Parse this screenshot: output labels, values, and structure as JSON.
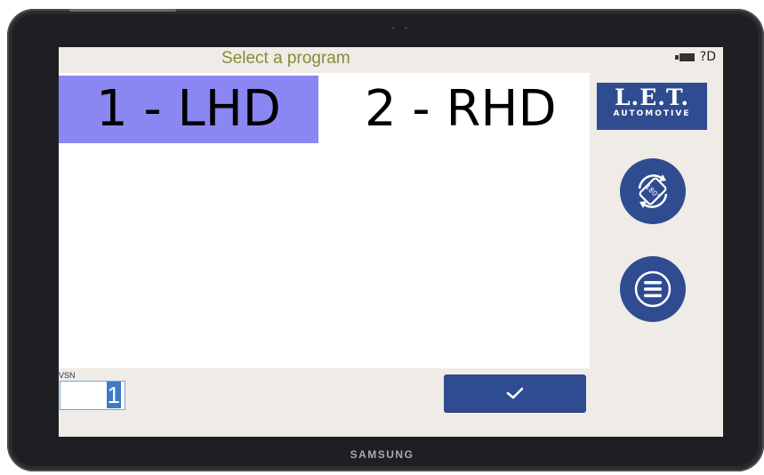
{
  "header": {
    "title": "Select a program",
    "status_text": "?D"
  },
  "programs": [
    {
      "label": "1 - LHD",
      "selected": true
    },
    {
      "label": "2 - RHD",
      "selected": false
    }
  ],
  "logo": {
    "main": "L.E.T.",
    "sub": "AUTOMOTIVE"
  },
  "rotate_button": {
    "icon": "rotate-180-icon",
    "text": "180°"
  },
  "menu_button": {
    "icon": "hamburger-menu-icon"
  },
  "vsn": {
    "label": "VSN",
    "value": "1"
  },
  "confirm_button": {
    "icon": "check-icon"
  },
  "device": {
    "brand": "SAMSUNG"
  },
  "colors": {
    "accent": "#2f4c91",
    "selected": "#8a86f2",
    "title": "#8a8a3a",
    "screen_bg": "#efebe6"
  }
}
